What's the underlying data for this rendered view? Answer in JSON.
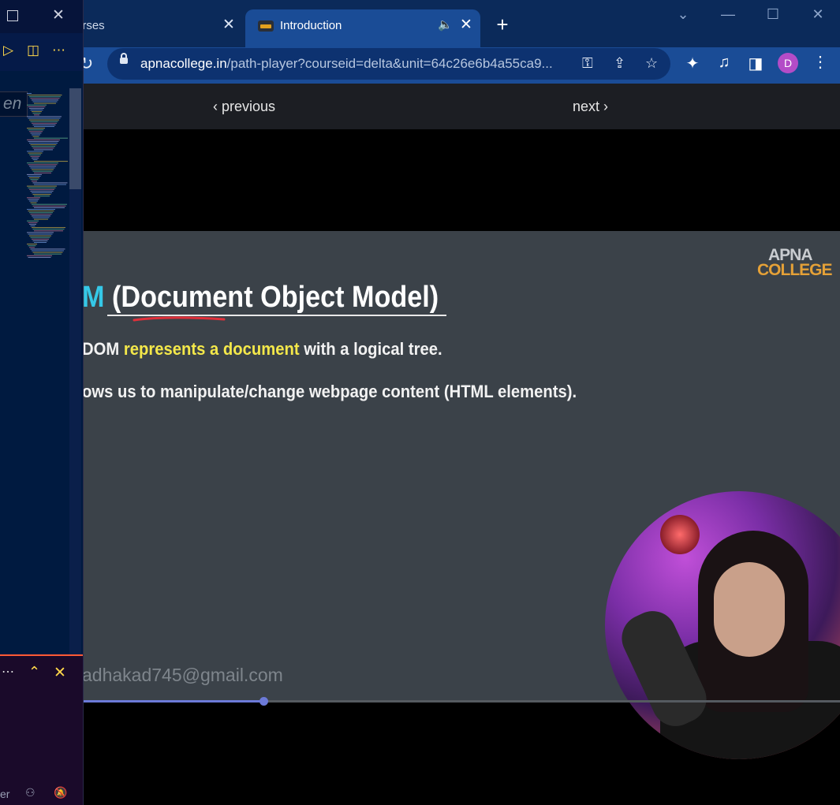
{
  "browser": {
    "tabs": [
      {
        "label": "urses",
        "active": false
      },
      {
        "label": "Introduction",
        "active": true
      }
    ],
    "new_tab": "+",
    "window_controls": {
      "minimize": "—",
      "maximize": "☐",
      "close": "✕",
      "tab_search": "⌄"
    },
    "url_host": "apnacollege.in",
    "url_path": "/path-player?courseid=delta&unit=64c26e6b4a55ca9...",
    "profile_initial": "D",
    "icons": [
      "reload-icon",
      "lock-icon",
      "key-icon",
      "share-icon",
      "star-icon",
      "extensions-icon",
      "media-control-icon",
      "side-panel-icon",
      "kebab-menu-icon"
    ]
  },
  "player": {
    "previous_label": "previous",
    "next_label": "next",
    "progress": 0.314,
    "watermark": "adhakad745@gmail.com"
  },
  "slide": {
    "title_prefix": "M",
    "title_rest": " (Document Object Model)",
    "line1_pre": "DOM ",
    "line1_highlight": "represents a document",
    "line1_post": " with a logical tree.",
    "line2": "ows us to manipulate/change webpage content (HTML elements).",
    "logo_line1": "APNA",
    "logo_line2": "COLLEGE",
    "accent": "#35c8e8",
    "highlight": "#f4e84a"
  },
  "editor": {
    "search_text": "en",
    "action_icons": [
      "run-icon",
      "split-editor-icon",
      "more-actions-icon"
    ],
    "panel_icons": [
      "more-icon",
      "maximize-panel-icon",
      "close-panel-icon"
    ],
    "status_text": "er"
  },
  "colors": {
    "tabstrip": "#0b2a5a",
    "toolbar": "#1a4c96",
    "slide_bg": "#3b4249",
    "progress": "#6c7ad8",
    "editor_bg": "#001a40"
  }
}
